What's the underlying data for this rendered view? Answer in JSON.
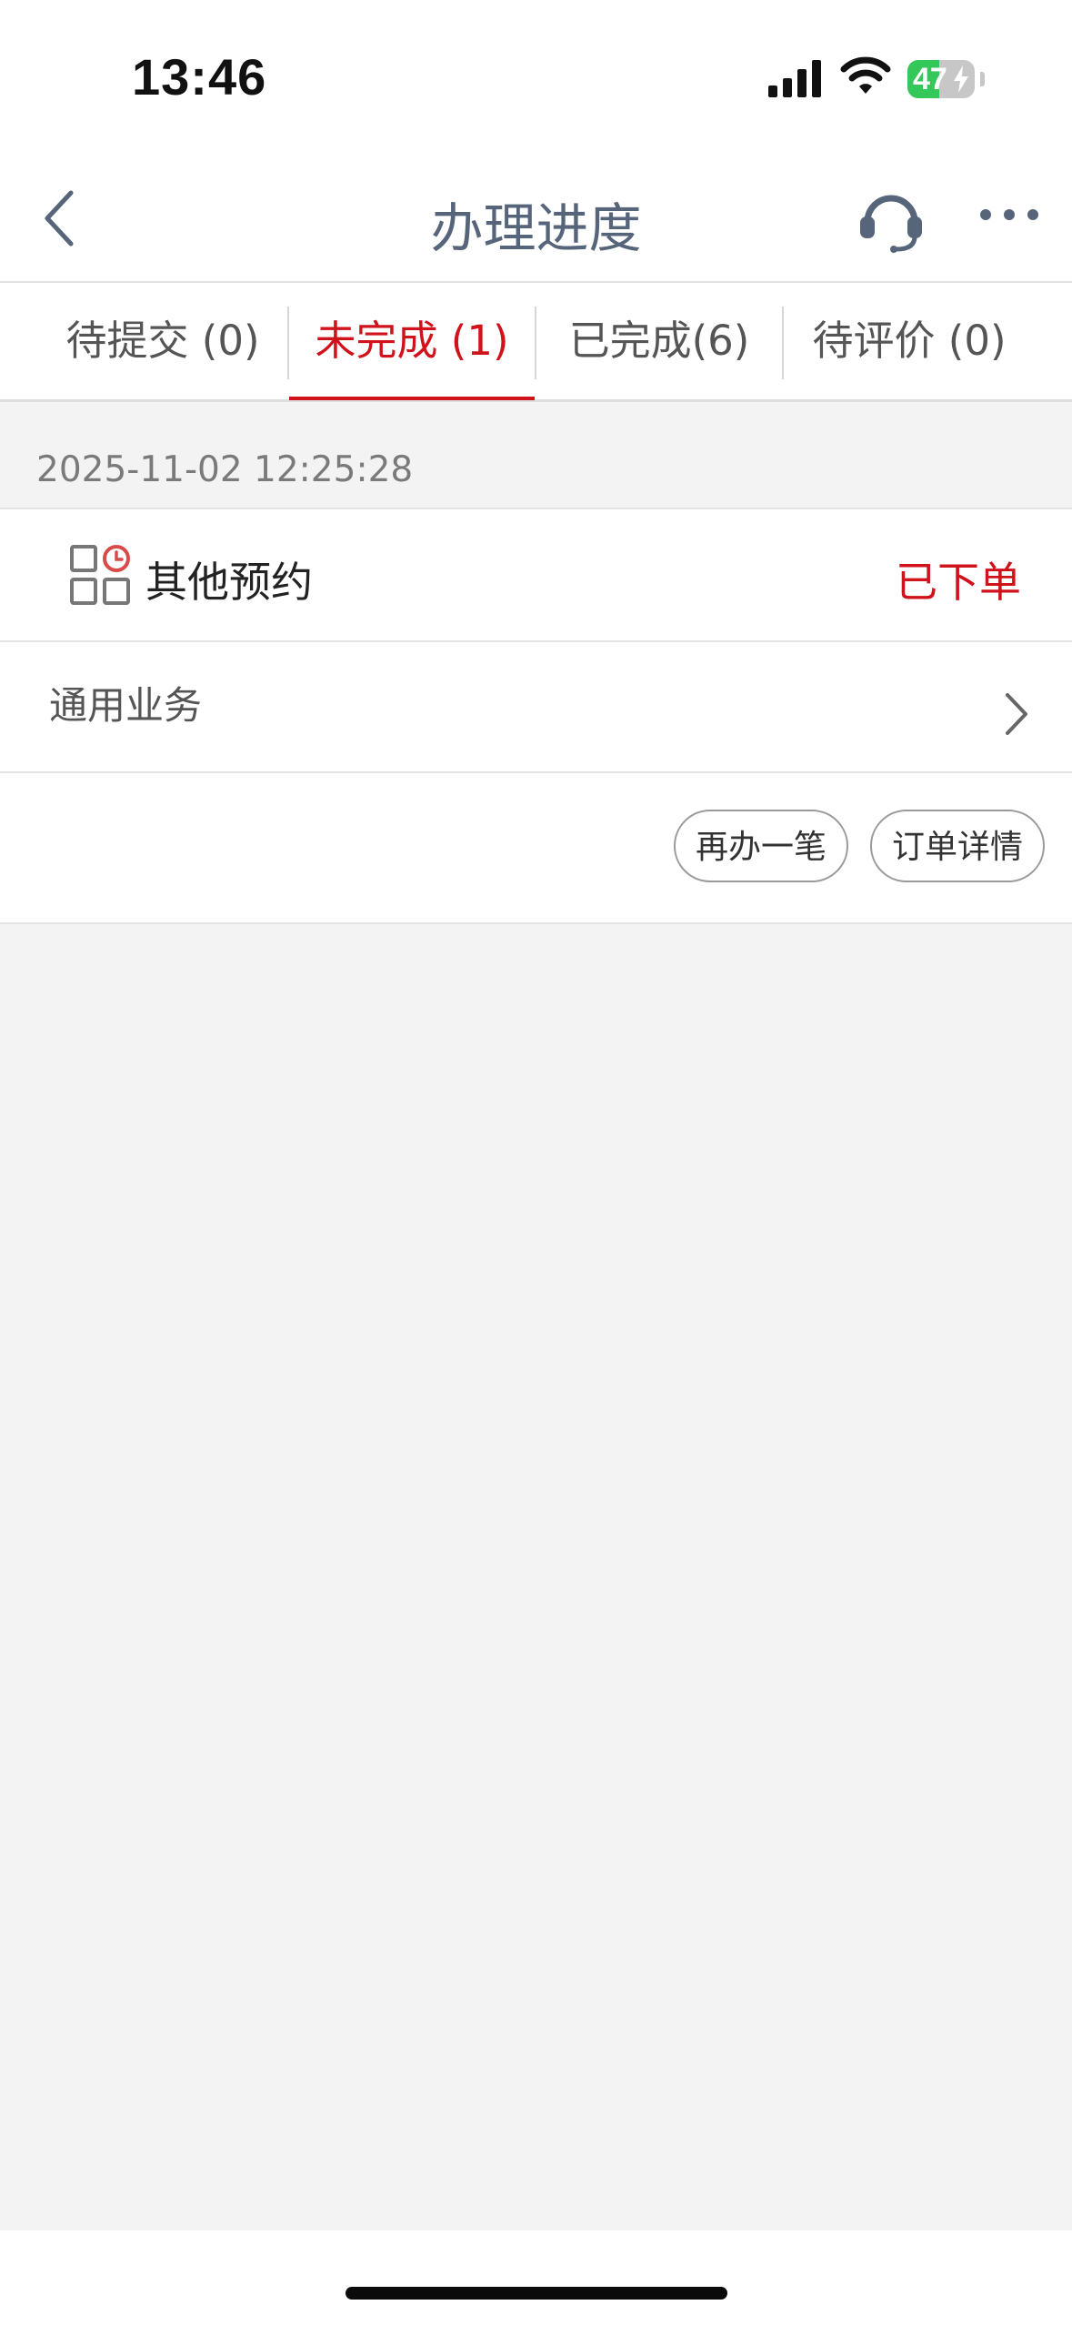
{
  "status_bar": {
    "time": "13:46",
    "battery_level": "47",
    "battery_fraction": 0.47,
    "icons": [
      "signal-icon",
      "wifi-icon",
      "battery-charging-icon"
    ]
  },
  "nav": {
    "title": "办理进度",
    "back_icon": "chevron-left-icon",
    "support_icon": "headset-icon",
    "more_icon": "more-icon"
  },
  "tabs": [
    {
      "label": "待提交 (0)",
      "active": false
    },
    {
      "label": "未完成 (1)",
      "active": true
    },
    {
      "label": "已完成(6)",
      "active": false
    },
    {
      "label": "待评价 (0)",
      "active": false
    }
  ],
  "order": {
    "date": "2025-11-02 12:25:28",
    "service_icon": "appointment-grid-icon",
    "service_name": "其他预约",
    "status": "已下单",
    "business_type": "通用业务",
    "actions": {
      "redo_label": "再办一笔",
      "details_label": "订单详情"
    }
  },
  "colors": {
    "accent": "#d0121b",
    "title": "#56657a",
    "background": "#f3f3f3",
    "battery_green": "#34c759"
  }
}
